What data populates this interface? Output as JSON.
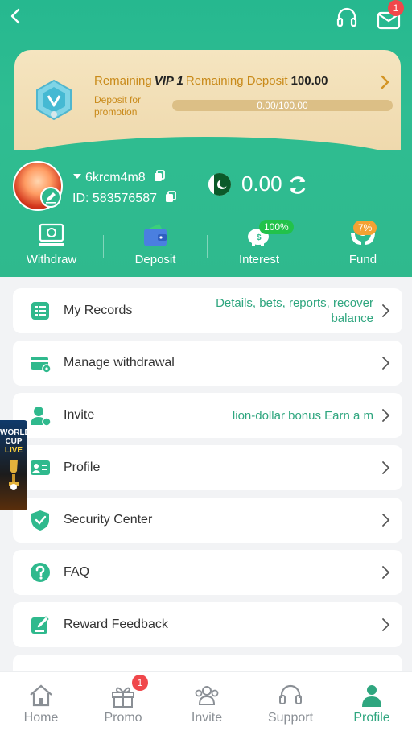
{
  "header": {
    "mail_badge": "1"
  },
  "vip": {
    "remaining_label": "Remaining",
    "level": "VIP 1",
    "remaining_deposit_label": "Remaining Deposit",
    "remaining_deposit_value": "100.00",
    "subtitle": "Deposit for promotion",
    "progress_text": "0.00/100.00",
    "progress_fraction": 0
  },
  "user": {
    "username": "6krcm4m8",
    "id_label": "ID:",
    "id_value": "583576587",
    "balance": "0.00"
  },
  "quick_actions": [
    {
      "label": "Withdraw",
      "icon": "withdraw-icon"
    },
    {
      "label": "Deposit",
      "icon": "wallet-icon"
    },
    {
      "label": "Interest",
      "icon": "piggy-bank-icon",
      "pill": "100%"
    },
    {
      "label": "Fund",
      "icon": "fund-hands-icon",
      "pill": "7%"
    }
  ],
  "menu": [
    {
      "label": "My Records",
      "extra": "Details, bets, reports, recover balance",
      "icon": "records-icon"
    },
    {
      "label": "Manage withdrawal",
      "extra": "",
      "icon": "card-settings-icon"
    },
    {
      "label": "Invite",
      "extra": "lion-dollar bonus  Earn a m",
      "icon": "invite-user-icon"
    },
    {
      "label": "Profile",
      "extra": "",
      "icon": "id-card-icon"
    },
    {
      "label": "Security Center",
      "extra": "",
      "icon": "shield-check-icon"
    },
    {
      "label": "FAQ",
      "extra": "",
      "icon": "question-icon"
    },
    {
      "label": "Reward Feedback",
      "extra": "",
      "icon": "feedback-icon"
    }
  ],
  "floater": {
    "line1": "WORLD",
    "line2": "CUP",
    "line3": "LIVE"
  },
  "tabbar": {
    "items": [
      {
        "label": "Home",
        "icon": "home-icon"
      },
      {
        "label": "Promo",
        "icon": "gift-icon"
      },
      {
        "label": "Invite",
        "icon": "users-icon"
      },
      {
        "label": "Support",
        "icon": "headset-icon"
      },
      {
        "label": "Profile",
        "icon": "profile-icon"
      }
    ],
    "promo_badge": "1",
    "active": "Profile"
  },
  "colors": {
    "brand_green": "#2fb98d",
    "accent_gold": "#c98a1a",
    "badge_red": "#f0474b"
  }
}
